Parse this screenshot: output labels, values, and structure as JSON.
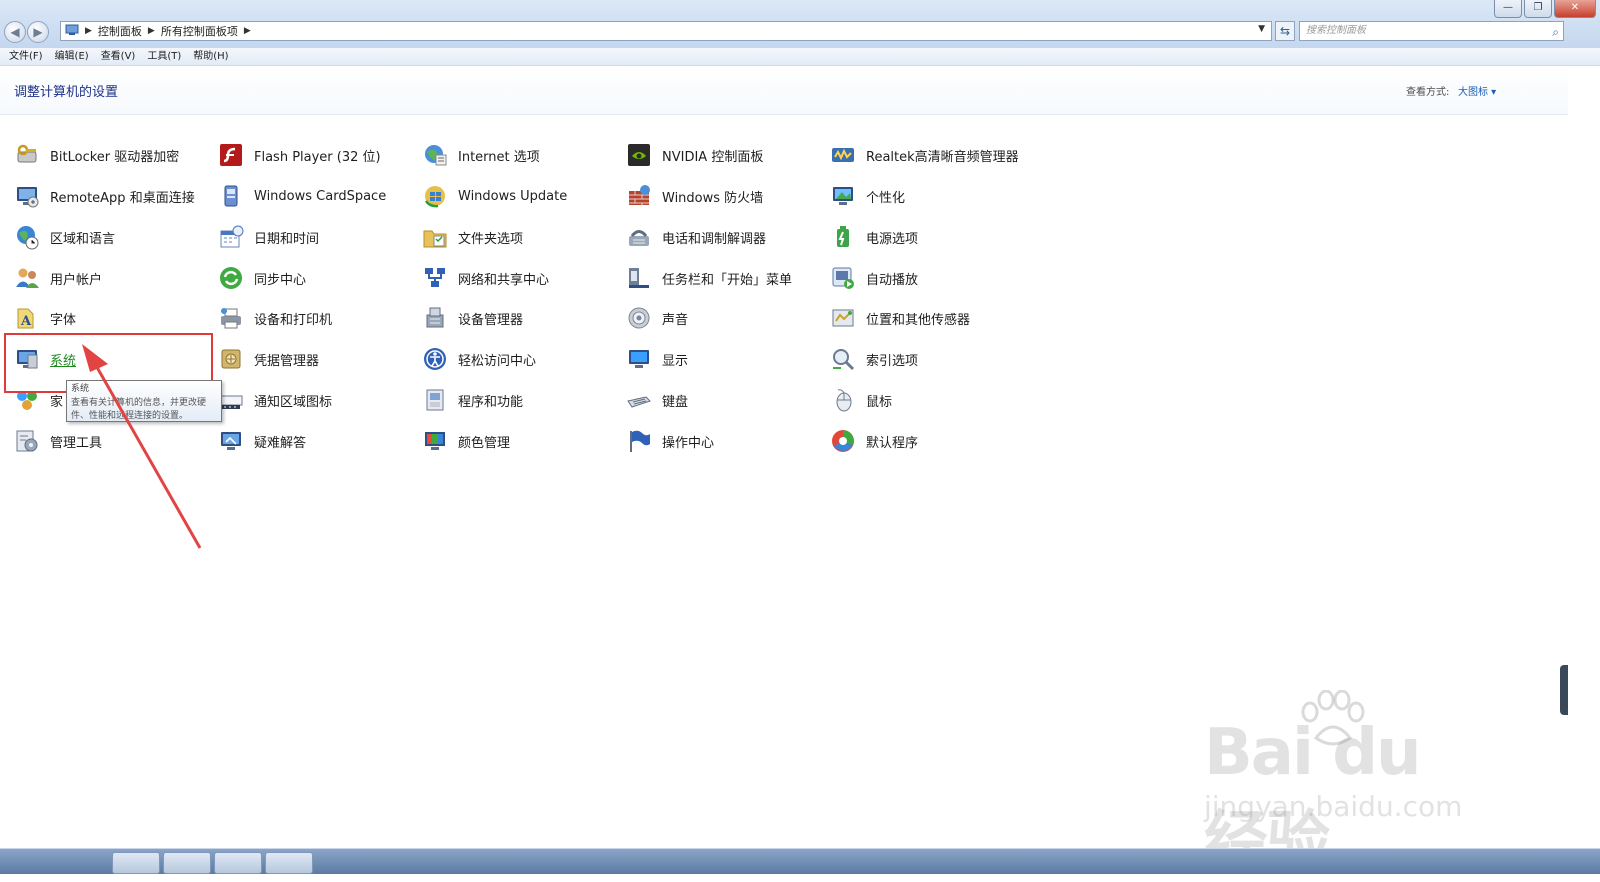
{
  "breadcrumb": [
    "控制面板",
    "所有控制面板项"
  ],
  "search": {
    "placeholder": "搜索控制面板"
  },
  "menu": [
    "文件(F)",
    "编辑(E)",
    "查看(V)",
    "工具(T)",
    "帮助(H)"
  ],
  "header": {
    "title": "调整计算机的设置",
    "view_label": "查看方式:",
    "view_value": "大图标 ▾"
  },
  "items": [
    {
      "label": "BitLocker 驱动器加密",
      "icon": "bitlocker-key-icon"
    },
    {
      "label": "Flash Player (32 位)",
      "icon": "flash-player-icon"
    },
    {
      "label": "Internet 选项",
      "icon": "internet-options-icon"
    },
    {
      "label": "NVIDIA 控制面板",
      "icon": "nvidia-icon"
    },
    {
      "label": "Realtek高清晰音频管理器",
      "icon": "realtek-audio-icon"
    },
    {
      "label": "RemoteApp 和桌面连接",
      "icon": "remote-desktop-icon"
    },
    {
      "label": "Windows CardSpace",
      "icon": "cardspace-icon"
    },
    {
      "label": "Windows Update",
      "icon": "windows-update-icon"
    },
    {
      "label": "Windows 防火墙",
      "icon": "firewall-icon"
    },
    {
      "label": "个性化",
      "icon": "personalization-icon"
    },
    {
      "label": "区域和语言",
      "icon": "globe-clock-icon"
    },
    {
      "label": "日期和时间",
      "icon": "calendar-icon"
    },
    {
      "label": "文件夹选项",
      "icon": "folder-options-icon"
    },
    {
      "label": "电话和调制解调器",
      "icon": "phone-modem-icon"
    },
    {
      "label": "电源选项",
      "icon": "power-options-icon"
    },
    {
      "label": "用户帐户",
      "icon": "user-accounts-icon"
    },
    {
      "label": "同步中心",
      "icon": "sync-center-icon"
    },
    {
      "label": "网络和共享中心",
      "icon": "network-icon"
    },
    {
      "label": "任务栏和「开始」菜单",
      "icon": "taskbar-icon"
    },
    {
      "label": "自动播放",
      "icon": "autoplay-icon"
    },
    {
      "label": "字体",
      "icon": "fonts-icon"
    },
    {
      "label": "设备和打印机",
      "icon": "printer-icon"
    },
    {
      "label": "设备管理器",
      "icon": "device-manager-icon"
    },
    {
      "label": "声音",
      "icon": "speaker-icon"
    },
    {
      "label": "位置和其他传感器",
      "icon": "sensor-icon"
    },
    {
      "label": "系统",
      "icon": "system-monitor-icon"
    },
    {
      "label": "凭据管理器",
      "icon": "credential-vault-icon"
    },
    {
      "label": "轻松访问中心",
      "icon": "ease-of-access-icon"
    },
    {
      "label": "显示",
      "icon": "display-monitor-icon"
    },
    {
      "label": "索引选项",
      "icon": "indexing-magnifier-icon"
    },
    {
      "label": "家",
      "icon": "homegroup-icon"
    },
    {
      "label": "通知区域图标",
      "icon": "notification-area-icon"
    },
    {
      "label": "程序和功能",
      "icon": "programs-icon"
    },
    {
      "label": "键盘",
      "icon": "keyboard-icon"
    },
    {
      "label": "鼠标",
      "icon": "mouse-icon"
    },
    {
      "label": "管理工具",
      "icon": "admin-tools-icon"
    },
    {
      "label": "疑难解答",
      "icon": "troubleshooting-icon"
    },
    {
      "label": "颜色管理",
      "icon": "color-management-icon"
    },
    {
      "label": "操作中心",
      "icon": "action-center-flag-icon"
    },
    {
      "label": "默认程序",
      "icon": "default-programs-icon"
    }
  ],
  "tooltip": {
    "title": "系统",
    "body": "查看有关计算机的信息，并更改硬件、性能和远程连接的设置。"
  },
  "watermark": {
    "main": "Bai du 经验",
    "sub": "jingyan.baidu.com"
  },
  "colors": {
    "accent_link": "#1e3287",
    "hover_green": "#1f8a1f",
    "annotation_red": "#e03b3b"
  }
}
